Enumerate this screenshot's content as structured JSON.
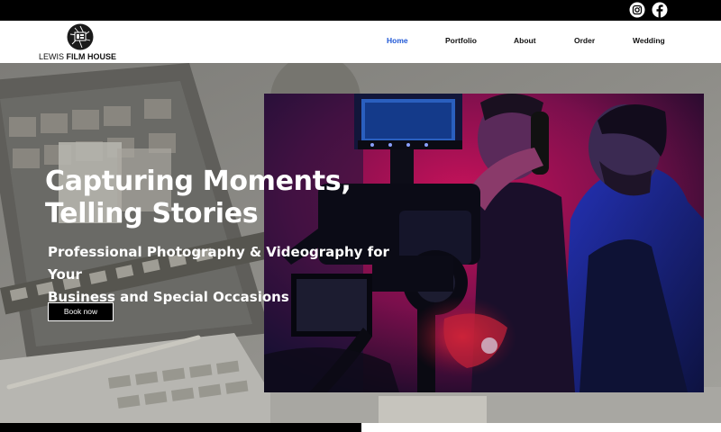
{
  "brand": {
    "name_light": "LEWIS",
    "name_bold": "FILM HOUSE"
  },
  "socials": [
    {
      "name": "instagram-icon",
      "color": "#ffffff"
    },
    {
      "name": "facebook-icon",
      "color": "#ffffff"
    }
  ],
  "nav": {
    "items": [
      {
        "label": "Home",
        "active": true
      },
      {
        "label": "Portfolio",
        "active": false
      },
      {
        "label": "About",
        "active": false
      },
      {
        "label": "Order",
        "active": false
      },
      {
        "label": "Wedding",
        "active": false
      }
    ],
    "active_color": "#1f57d6"
  },
  "hero": {
    "title_line1": "Capturing Moments,",
    "title_line2": "Telling Stories",
    "subtitle_line1": "Professional Photography & Videography for Your",
    "subtitle_line2": "Business and Special Occasions",
    "cta_label": "Book now"
  },
  "colors": {
    "topbar": "#000000",
    "photo_magenta": "#c8125a",
    "photo_blue": "#1a2aa8"
  }
}
